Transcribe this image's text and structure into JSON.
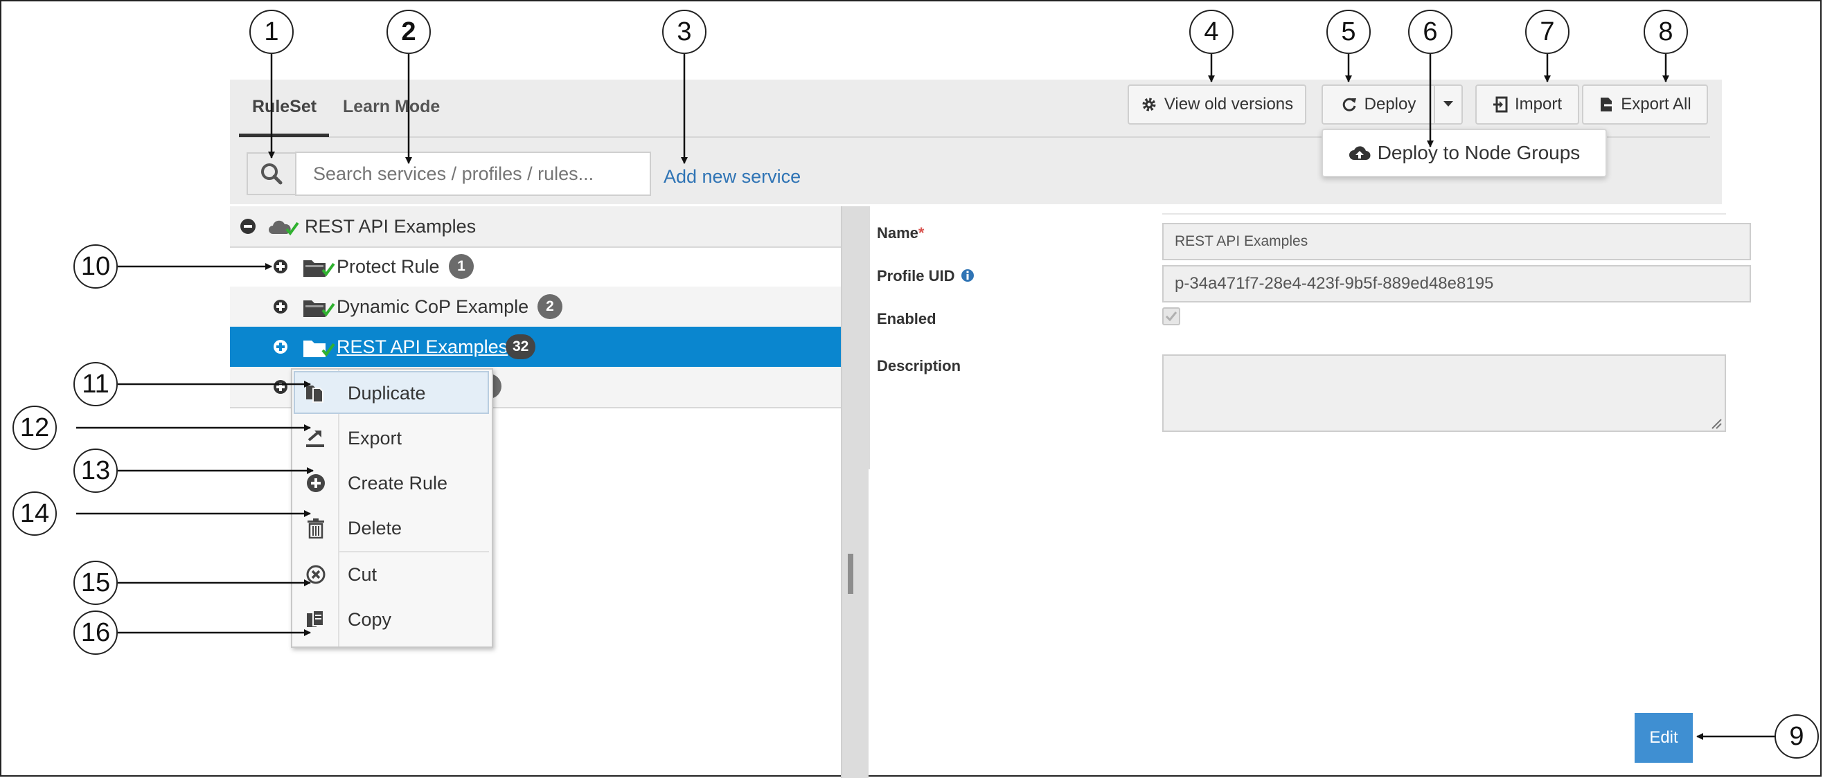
{
  "tabs": [
    {
      "label": "RuleSet"
    },
    {
      "label": "Learn Mode"
    }
  ],
  "search": {
    "placeholder": "Search services / profiles / rules..."
  },
  "add_service_label": "Add new service",
  "toolbar": {
    "view_old_versions": "View old versions",
    "deploy": "Deploy",
    "import": "Import",
    "export_all": "Export All",
    "deploy_menu_item": "Deploy to Node Groups"
  },
  "tree": {
    "root": {
      "label": "REST API Examples"
    },
    "children": [
      {
        "label": "Protect Rule",
        "count": "1"
      },
      {
        "label": "Dynamic CoP Example",
        "count": "2"
      },
      {
        "label": "REST API Examples",
        "count": "32",
        "selected": true
      }
    ]
  },
  "context_menu": {
    "items": [
      {
        "label": "Duplicate",
        "icon": "duplicate-icon"
      },
      {
        "label": "Export",
        "icon": "export-icon"
      },
      {
        "label": "Create Rule",
        "icon": "plus-circle-icon"
      },
      {
        "label": "Delete",
        "icon": "trash-icon"
      },
      {
        "label": "Cut",
        "icon": "cut-icon"
      },
      {
        "label": "Copy",
        "icon": "copy-icon"
      }
    ]
  },
  "details": {
    "name_label": "Name",
    "required_mark": "*",
    "name_value": "REST API Examples",
    "uid_label": "Profile UID",
    "uid_value": "p-34a471f7-28e4-423f-9b5f-889ed48e8195",
    "enabled_label": "Enabled",
    "enabled": true,
    "description_label": "Description",
    "description_value": ""
  },
  "edit_label": "Edit",
  "callouts": [
    "1",
    "2",
    "3",
    "4",
    "5",
    "6",
    "7",
    "8",
    "9",
    "10",
    "11",
    "12",
    "13",
    "14",
    "15",
    "16"
  ],
  "colors": {
    "selected_row": "#0a86cf",
    "link": "#2f74b5",
    "edit_button": "#3f8fd2",
    "check_green": "#2fb12f",
    "badge": "#6b6b6b"
  }
}
